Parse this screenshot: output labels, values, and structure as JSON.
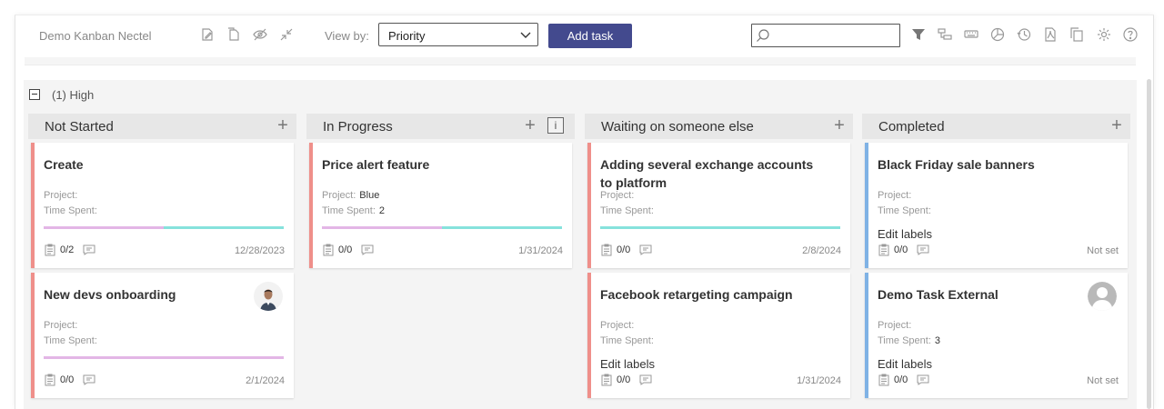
{
  "app": {
    "title": "Demo Kanban Nectel"
  },
  "toolbar": {
    "view_by_label": "View by:",
    "view_by_value": "Priority",
    "add_task_label": "Add task",
    "search_value": "",
    "search_placeholder": ""
  },
  "group": {
    "toggle": "−",
    "label": "(1) High"
  },
  "columns": [
    {
      "title": "Not Started",
      "plus": "+"
    },
    {
      "title": "In Progress",
      "plus": "+",
      "info": "i"
    },
    {
      "title": "Waiting on someone else",
      "plus": "+"
    },
    {
      "title": "Completed",
      "plus": "+"
    }
  ],
  "cards": {
    "c1": {
      "title": "Create",
      "project_label": "Project:",
      "project_value": "",
      "time_label": "Time Spent:",
      "time_value": "",
      "checklist": "0/2",
      "date": "12/28/2023"
    },
    "c2": {
      "title": "New devs onboarding",
      "project_label": "Project:",
      "project_value": "",
      "time_label": "Time Spent:",
      "time_value": "",
      "checklist": "0/0",
      "date": "2/1/2024"
    },
    "c3": {
      "title": "Price alert feature",
      "project_label": "Project:",
      "project_value": "Blue",
      "time_label": "Time Spent:",
      "time_value": "2",
      "checklist": "0/0",
      "date": "1/31/2024"
    },
    "c4": {
      "title": "Adding several exchange accounts to platform",
      "project_label": "Project:",
      "project_value": "",
      "time_label": "Time Spent:",
      "time_value": "",
      "checklist": "0/0",
      "date": "2/8/2024"
    },
    "c5": {
      "title": "Facebook retargeting campaign",
      "project_label": "Project:",
      "project_value": "",
      "time_label": "Time Spent:",
      "time_value": "",
      "edit_labels": "Edit labels",
      "checklist": "0/0",
      "date": "1/31/2024"
    },
    "c6": {
      "title": "Black Friday sale banners",
      "project_label": "Project:",
      "project_value": "",
      "time_label": "Time Spent:",
      "time_value": "",
      "edit_labels": "Edit labels",
      "checklist": "0/0",
      "date": "Not set"
    },
    "c7": {
      "title": "Demo Task External",
      "project_label": "Project:",
      "project_value": "",
      "time_label": "Time Spent:",
      "time_value": "3",
      "edit_labels": "Edit labels",
      "checklist": "0/0",
      "date": "Not set"
    }
  },
  "colors": {
    "accent_button": "#434a8e",
    "priority_high": "#ef8f8a",
    "completed": "#7fb2e5",
    "bar_pink": "#e3b6e6",
    "bar_teal": "#86e2dc"
  }
}
